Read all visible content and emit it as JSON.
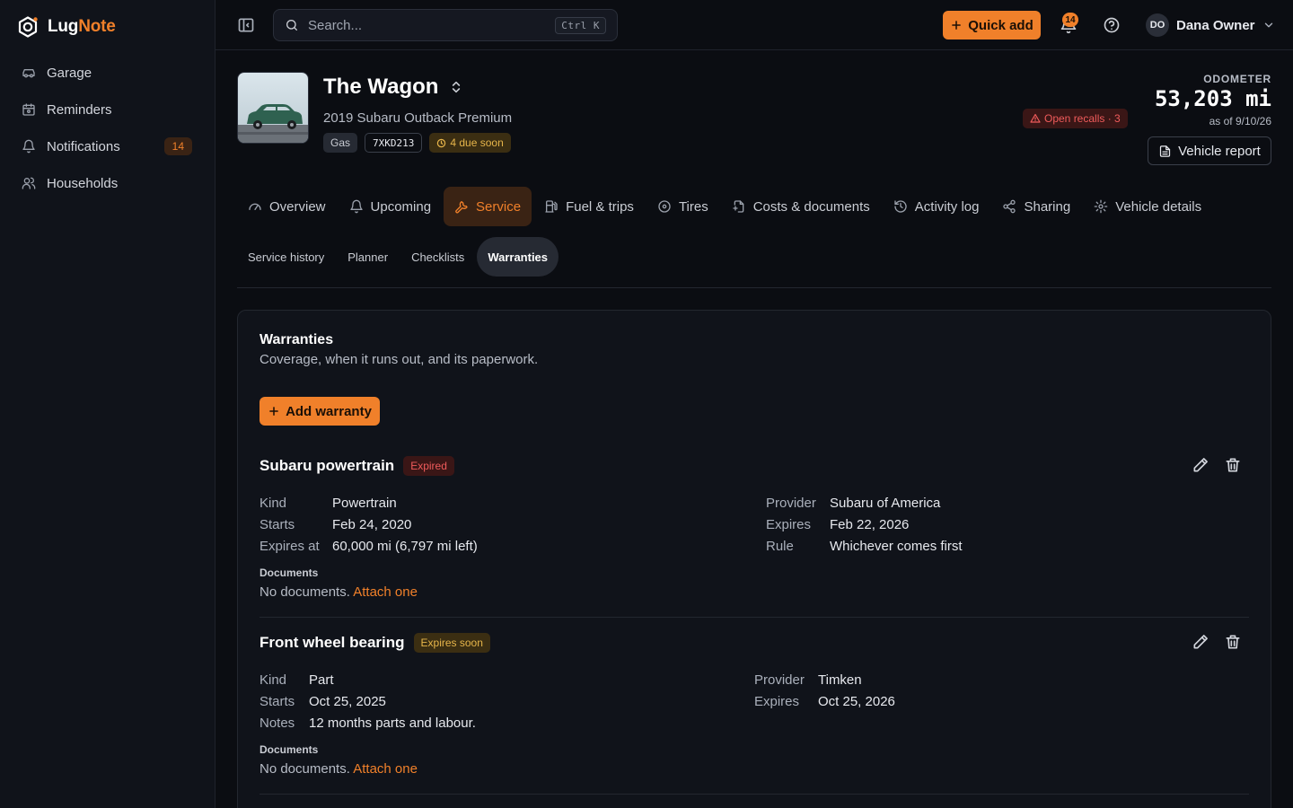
{
  "app": {
    "brand_main": "Lug",
    "brand_accent": "Note",
    "accent_color": "#f0802a"
  },
  "sidebar": {
    "items": [
      {
        "label": "Garage",
        "icon": "car-icon"
      },
      {
        "label": "Reminders",
        "icon": "calendar-icon"
      },
      {
        "label": "Notifications",
        "icon": "bell-icon",
        "count": "14"
      },
      {
        "label": "Households",
        "icon": "users-icon"
      }
    ]
  },
  "topbar": {
    "search_placeholder": "Search...",
    "search_shortcut": "Ctrl K",
    "quick_add_label": "Quick add",
    "notification_count": "14",
    "user_initials": "DO",
    "user_name": "Dana Owner"
  },
  "vehicle": {
    "name": "The Wagon",
    "subtitle": "2019 Subaru Outback Premium",
    "fuel_chip": "Gas",
    "plate": "7XKD213",
    "due_chip": "4 due soon",
    "recalls": "Open recalls · 3",
    "odometer_label": "ODOMETER",
    "odometer_value": "53,203 mi",
    "odometer_date": "as of 9/10/26",
    "report_label": "Vehicle report"
  },
  "tabs": [
    {
      "label": "Overview",
      "icon": "gauge-icon"
    },
    {
      "label": "Upcoming",
      "icon": "bell-icon"
    },
    {
      "label": "Service",
      "icon": "wrench-icon",
      "active": true
    },
    {
      "label": "Fuel & trips",
      "icon": "fuel-pump-icon"
    },
    {
      "label": "Tires",
      "icon": "circle-icon"
    },
    {
      "label": "Costs & documents",
      "icon": "receipt-icon"
    },
    {
      "label": "Activity log",
      "icon": "history-icon"
    },
    {
      "label": "Sharing",
      "icon": "share-icon"
    },
    {
      "label": "Vehicle details",
      "icon": "gear-icon"
    }
  ],
  "subtabs": [
    {
      "label": "Service history"
    },
    {
      "label": "Planner"
    },
    {
      "label": "Checklists"
    },
    {
      "label": "Warranties",
      "active": true
    }
  ],
  "warranties_card": {
    "title": "Warranties",
    "subtitle": "Coverage, when it runs out, and its paperwork.",
    "add_label": "Add warranty",
    "docs_label": "Documents",
    "docs_empty": "No documents.",
    "docs_attach": "Attach one",
    "items": [
      {
        "name": "Subaru powertrain",
        "status": "Expired",
        "left": [
          {
            "k": "Kind",
            "v": "Powertrain"
          },
          {
            "k": "Starts",
            "v": "Feb 24, 2020"
          },
          {
            "k": "Expires at",
            "v": "60,000 mi (6,797 mi left)"
          }
        ],
        "right": [
          {
            "k": "Provider",
            "v": "Subaru of America"
          },
          {
            "k": "Expires",
            "v": "Feb 22, 2026"
          },
          {
            "k": "Rule",
            "v": "Whichever comes first"
          }
        ]
      },
      {
        "name": "Front wheel bearing",
        "status": "Expires soon",
        "left": [
          {
            "k": "Kind",
            "v": "Part"
          },
          {
            "k": "Starts",
            "v": "Oct 25, 2025"
          },
          {
            "k": "Notes",
            "v": "12 months parts and labour."
          }
        ],
        "right": [
          {
            "k": "Provider",
            "v": "Timken"
          },
          {
            "k": "Expires",
            "v": "Oct 25, 2026"
          }
        ]
      }
    ]
  }
}
